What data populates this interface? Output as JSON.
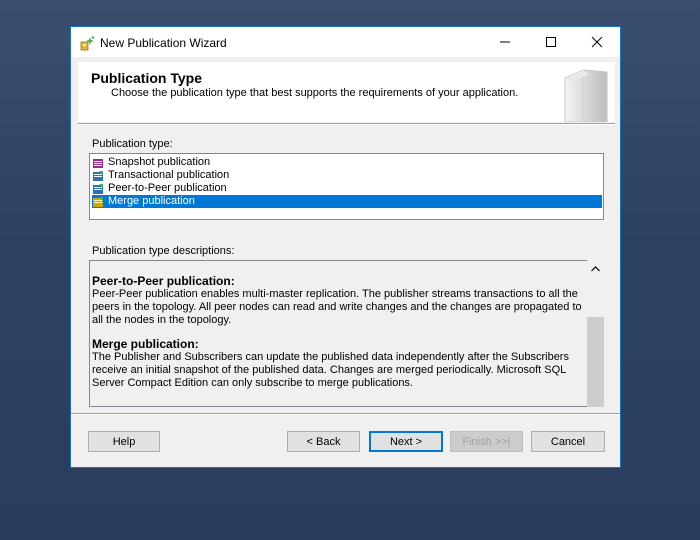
{
  "window": {
    "title": "New Publication Wizard",
    "icon": "wizard-icon",
    "controls": {
      "minimize": "─",
      "maximize": "☐",
      "close": "✕"
    }
  },
  "header": {
    "title": "Publication Type",
    "subtitle": "Choose the publication type that best supports the requirements of your application."
  },
  "publication_types": {
    "label": "Publication type:",
    "items": [
      {
        "label": "Snapshot publication",
        "icon": "snapshot-icon",
        "color": "#a0288c",
        "selected": false
      },
      {
        "label": "Transactional publication",
        "icon": "transactional-icon",
        "color": "#2f6fb5",
        "selected": false
      },
      {
        "label": "Peer-to-Peer publication",
        "icon": "peer-to-peer-icon",
        "color": "#2f6fb5",
        "selected": false
      },
      {
        "label": "Merge publication",
        "icon": "merge-icon",
        "color": "#c8a800",
        "selected": true
      }
    ]
  },
  "descriptions": {
    "label": "Publication type descriptions:",
    "entries": [
      {
        "heading": "Peer-to-Peer publication:",
        "text": "Peer-Peer publication enables multi-master replication. The publisher streams transactions to all the peers in the topology. All peer nodes can read and write changes and the changes are propagated to all the nodes in the topology."
      },
      {
        "heading": "Merge publication:",
        "text": "The Publisher and Subscribers can update the published data independently after the Subscribers receive an initial snapshot of the published data. Changes are merged periodically. Microsoft SQL Server Compact Edition can only subscribe to merge publications."
      }
    ]
  },
  "buttons": {
    "help": "Help",
    "back": "< Back",
    "next": "Next >",
    "finish": "Finish >>|",
    "cancel": "Cancel"
  },
  "colors": {
    "accent": "#0078d7",
    "window_border": "#1a74c4"
  }
}
